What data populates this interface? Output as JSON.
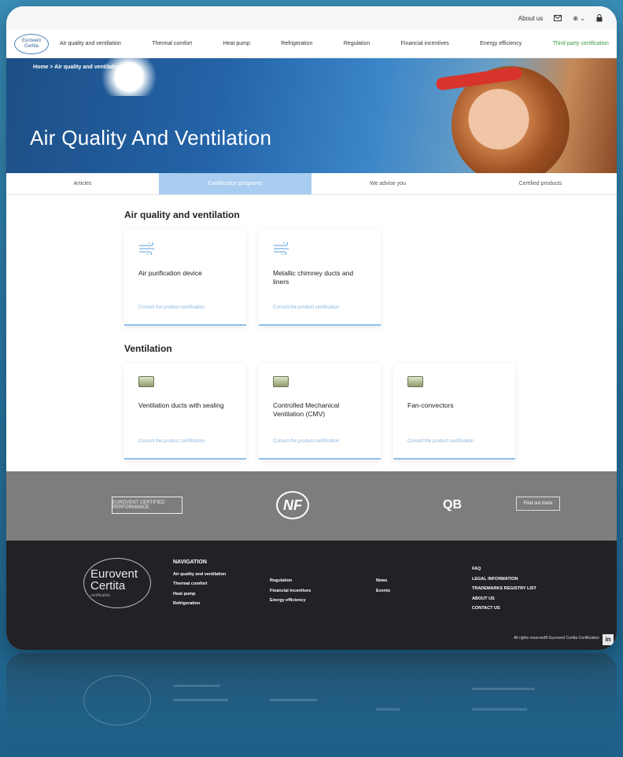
{
  "topbar": {
    "about": "About us",
    "mail_icon": "mail-icon",
    "lang": "⊕ ⌄",
    "lock_icon": "lock-icon"
  },
  "nav": {
    "logo_line1": "Eurovent",
    "logo_line2": "Certita",
    "items": [
      "Air quality and ventilation",
      "Thermal comfort",
      "Heat pump",
      "Refrigeration",
      "Regulation",
      "Financial incentives",
      "Energy efficiency"
    ],
    "cta": "Third-party certification"
  },
  "hero": {
    "breadcrumb": "Home > Air quality and ventilation",
    "title": "Air Quality And Ventilation"
  },
  "tabs": [
    "Articles",
    "Certification programs",
    "We advise you",
    "Certified products"
  ],
  "sections": [
    {
      "title": "Air quality and ventilation",
      "cards": [
        {
          "icon": "airflow-icon",
          "title": "Air purification device",
          "link": "Consult the product certification"
        },
        {
          "icon": "airflow-icon",
          "title": "Metallic chimney ducts and liners",
          "link": "Consult the product certification"
        }
      ]
    },
    {
      "title": "Ventilation",
      "cards": [
        {
          "icon": "product-box-icon",
          "title": "Ventilation ducts with sealing",
          "link": "Consult the product certification"
        },
        {
          "icon": "product-box-icon",
          "title": "Controlled Mechanical Ventilation (CMV)",
          "link": "Consult the product certification"
        },
        {
          "icon": "product-box-icon",
          "title": "Fan-convectors",
          "link": "Consult the product certification"
        }
      ]
    }
  ],
  "partners": {
    "eurovent": "EUROVENT CERTIFIED PERFORMANCE",
    "nf": "NF",
    "qb": "QB",
    "find_out_more": "Find out more"
  },
  "footer": {
    "logo_line1": "Eurovent",
    "logo_line2": "Certita",
    "logo_sub": "certification",
    "nav_heading": "NAVIGATION",
    "col1": [
      "Air quality and ventilation",
      "Thermal comfort",
      "Heat pump",
      "Refrigeration"
    ],
    "col2": [
      "Regulation",
      "Financial incentives",
      "Energy efficiency"
    ],
    "col3": [
      "News",
      "Events"
    ],
    "col4": [
      "FAQ",
      "LEGAL INFORMATION",
      "TRADEMARKS REGISTRY LIST",
      "ABOUT US",
      "CONTACT US"
    ],
    "copyright": "All rights reserved® Eurovent Certita Certification",
    "linkedin": "in"
  }
}
